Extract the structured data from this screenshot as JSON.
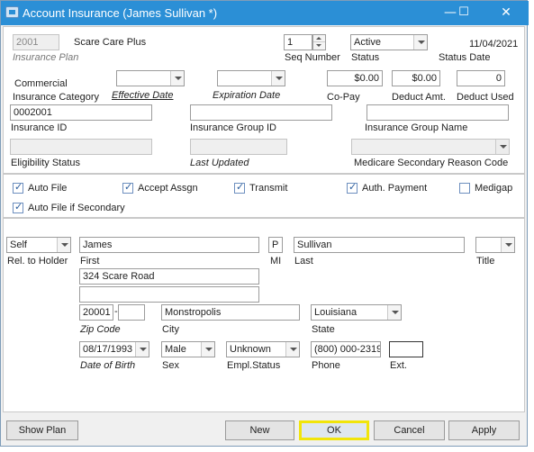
{
  "window": {
    "title": "Account Insurance (James Sullivan *)",
    "controls": {
      "minimize": "—",
      "maximize": "☐",
      "close": "✕"
    }
  },
  "plan": {
    "code": "2001",
    "name": "Scare Care Plus",
    "code_label": "Insurance Plan",
    "seq_number": "1",
    "seq_label": "Seq Number",
    "status": "Active",
    "status_label": "Status",
    "status_date": "11/04/2021",
    "status_date_label": "Status Date"
  },
  "category": {
    "value": "Commercial",
    "label": "Insurance Category",
    "effective_label": "Effective Date",
    "expiration_label": "Expiration Date",
    "copay": "$0.00",
    "copay_label": "Co-Pay",
    "deduct_amt": "$0.00",
    "deduct_amt_label": "Deduct Amt.",
    "deduct_used": "0",
    "deduct_used_label": "Deduct Used"
  },
  "ids": {
    "insurance_id": "0002001",
    "insurance_id_label": "Insurance ID",
    "group_id_label": "Insurance Group ID",
    "group_name_label": "Insurance Group Name",
    "eligibility_label": "Eligibility Status",
    "last_updated_label": "Last Updated",
    "medicare_label": "Medicare Secondary Reason Code"
  },
  "options": {
    "auto_file": {
      "label": "Auto File",
      "checked": true
    },
    "accept_assign": {
      "label": "Accept Assgn",
      "checked": true
    },
    "transmit": {
      "label": "Transmit",
      "checked": true
    },
    "auth_payment": {
      "label": "Auth. Payment",
      "checked": true
    },
    "medigap": {
      "label": "Medigap",
      "checked": false
    },
    "auto_file_secondary": {
      "label": "Auto File if Secondary",
      "checked": true
    }
  },
  "holder": {
    "relation": "Self",
    "relation_label": "Rel. to Holder",
    "first": "James",
    "first_label": "First",
    "mi": "P",
    "mi_label": "MI",
    "last": "Sullivan",
    "last_label": "Last",
    "title_label": "Title",
    "address1": "324 Scare Road",
    "address2": "",
    "zip": "20001",
    "zip_ext": "",
    "zip_label": "Zip Code",
    "city": "Monstropolis",
    "city_label": "City",
    "state": "Louisiana",
    "state_label": "State",
    "dob": "08/17/1993",
    "dob_label": "Date of Birth",
    "sex": "Male",
    "sex_label": "Sex",
    "empl_status": "Unknown",
    "empl_label": "Empl.Status",
    "phone": "(800) 000-2319",
    "phone_label": "Phone",
    "ext": "",
    "ext_label": "Ext."
  },
  "buttons": {
    "show_plan": "Show Plan",
    "new": "New",
    "ok": "OK",
    "cancel": "Cancel",
    "apply": "Apply"
  }
}
